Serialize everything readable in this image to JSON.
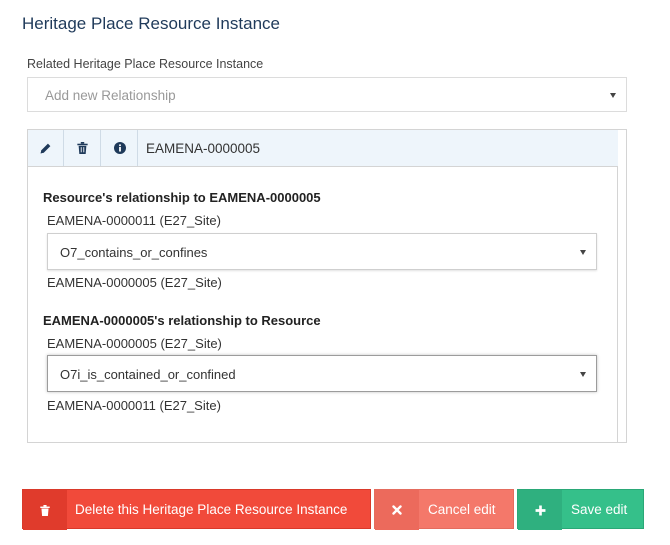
{
  "section": {
    "title": "Heritage Place Resource Instance"
  },
  "field": {
    "label": "Related Heritage Place Resource Instance",
    "placeholder": "Add new Relationship"
  },
  "panel": {
    "tools": [
      {
        "icon": "pencil-icon"
      },
      {
        "icon": "trash-icon"
      },
      {
        "icon": "info-icon"
      }
    ],
    "title": "EAMENA-0000005",
    "relationship_1": {
      "label": "Resource's relationship to EAMENA-0000005",
      "from": "EAMENA-0000011 (E27_Site)",
      "value": "O7_contains_or_confines",
      "to": "EAMENA-0000005 (E27_Site)"
    },
    "relationship_2": {
      "label": "EAMENA-0000005's relationship to Resource",
      "from": "EAMENA-0000005 (E27_Site)",
      "value": "O7i_is_contained_or_confined",
      "to": "EAMENA-0000011 (E27_Site)"
    }
  },
  "buttons": {
    "delete": {
      "label": "Delete this Heritage Place Resource Instance",
      "icon": "trash-icon",
      "color": "#f14a3a"
    },
    "cancel": {
      "label": "Cancel edit",
      "icon": "close-icon",
      "color": "#f4786a"
    },
    "save": {
      "label": "Save edit",
      "icon": "plus-icon",
      "color": "#35c08a"
    }
  }
}
